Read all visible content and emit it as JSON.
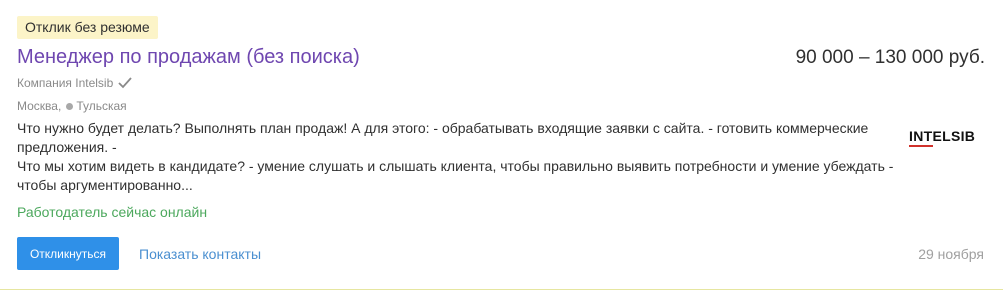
{
  "badge": "Отклик без резюме",
  "vacancy": {
    "title": "Менеджер по продажам (без поиска)",
    "salary": "90 000 – 130 000 руб.",
    "company": "Компания Intelsib",
    "city": "Москва,",
    "metro": "Тульская",
    "description": [
      "Что нужно будет делать? Выполнять план продаж! А для этого: - обрабатывать входящие заявки с сайта. - готовить коммерческие предложения. -",
      "Что мы хотим видеть в кандидате? - умение слушать и слышать клиента, чтобы правильно выявить потребности и умение убеждать - чтобы аргументированно..."
    ],
    "online_status": "Работодатель сейчас онлайн",
    "date": "29 ноября",
    "logo_text": "INTELSIB"
  },
  "actions": {
    "respond_label": "Откликнуться",
    "contacts_label": "Показать контакты"
  },
  "colors": {
    "title": "#6f47b0",
    "respond_button": "#2f90e8",
    "online": "#4ca85d",
    "badge_bg": "#fcf4c8",
    "link": "#4a8fd0"
  }
}
